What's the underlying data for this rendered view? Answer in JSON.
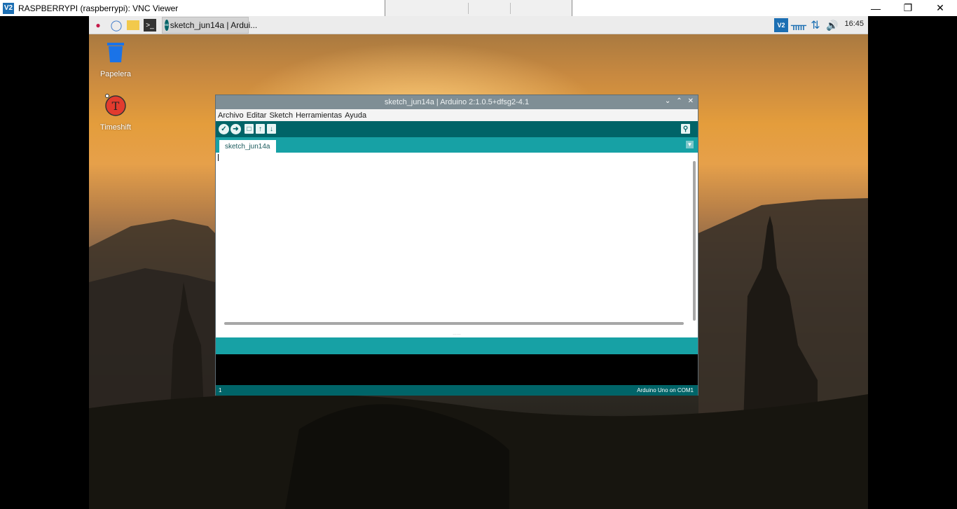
{
  "vnc": {
    "title": "RASPBERRYPI (raspberrypi): VNC Viewer",
    "logo": "V2",
    "minimize_icon": "minimize-icon",
    "restore_icon": "restore-icon",
    "close_icon": "close-icon"
  },
  "taskbar": {
    "apps": [
      "raspberry-menu-icon",
      "web-browser-icon",
      "file-manager-icon",
      "terminal-icon"
    ],
    "task_label": "sketch_jun14a | Ardui...",
    "tray": [
      "vnc-tray-icon",
      "bluetooth-icon",
      "network-icon",
      "volume-icon"
    ],
    "vnc_tray_text": "V2",
    "clock": "16:45"
  },
  "desktop_icons": [
    {
      "label": "Papelera",
      "icon": "trash-icon"
    },
    {
      "label": "Timeshift",
      "icon": "timeshift-icon"
    }
  ],
  "arduino": {
    "title": "sketch_jun14a | Arduino 2:1.0.5+dfsg2-4.1",
    "menu": [
      "Archivo",
      "Editar",
      "Sketch",
      "Herramientas",
      "Ayuda"
    ],
    "toolbar": [
      "verify-icon",
      "upload-icon",
      "new-icon",
      "open-icon",
      "save-icon",
      "serial-monitor-icon"
    ],
    "tab": "sketch_jun14a",
    "status_line": "1",
    "status_board": "Arduino Uno on COM1"
  },
  "colors": {
    "arduino_dark_teal": "#006468",
    "arduino_teal": "#17a1a5",
    "titlebar_grey": "#7f8e95"
  }
}
